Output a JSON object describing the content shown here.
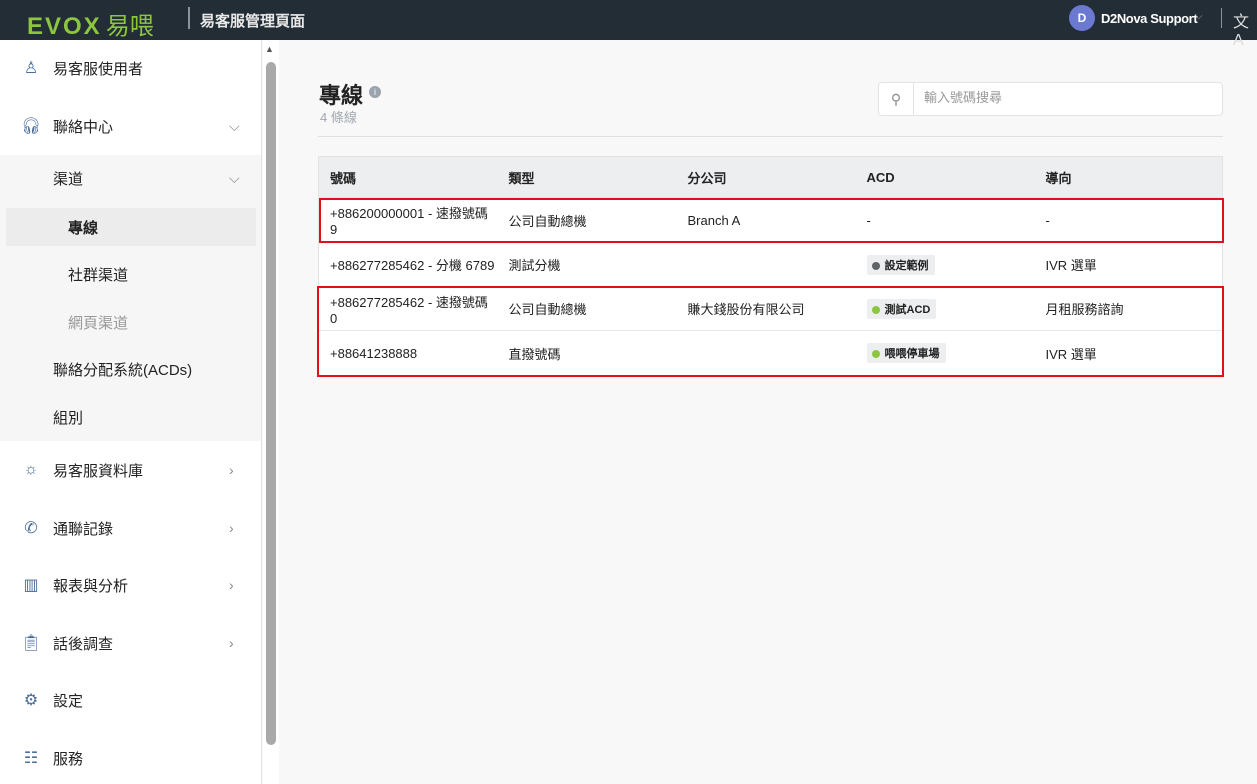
{
  "header": {
    "logo_text": "EVOX",
    "logo_cn": "易喂",
    "title": "易客服管理頁面",
    "avatar_initial": "D",
    "user_name": "D2Nova Support",
    "lang_icon": "translate-icon"
  },
  "sidebar": {
    "items": [
      {
        "label": "易客服使用者",
        "icon": "user-icon"
      },
      {
        "label": "聯絡中心",
        "icon": "headset-icon"
      },
      {
        "label": "渠道"
      },
      {
        "label": "專線"
      },
      {
        "label": "社群渠道"
      },
      {
        "label": "網頁渠道"
      },
      {
        "label": "聯絡分配系統(ACDs)"
      },
      {
        "label": "組別"
      },
      {
        "label": "易客服資料庫",
        "icon": "lightbulb-icon"
      },
      {
        "label": "通聯記錄",
        "icon": "phone-log-icon"
      },
      {
        "label": "報表與分析",
        "icon": "bar-chart-icon"
      },
      {
        "label": "話後調查",
        "icon": "clipboard-icon"
      },
      {
        "label": "設定",
        "icon": "gear-icon"
      },
      {
        "label": "服務",
        "icon": "list-icon"
      }
    ]
  },
  "main": {
    "title": "專線",
    "count": "4 條線",
    "search_placeholder": "輸入號碼搜尋",
    "columns": [
      "號碼",
      "類型",
      "分公司",
      "ACD",
      "導向"
    ],
    "rows": [
      {
        "number": "+886200000001 - 速撥號碼 9",
        "type": "公司自動總機",
        "branch": "Branch A",
        "acd": "-",
        "route": "-"
      },
      {
        "number": "+886277285462 - 分機 6789",
        "type": "測試分機",
        "branch": "",
        "acd": "設定範例",
        "acd_color": "#5f6368",
        "route": "IVR 選單"
      },
      {
        "number": "+886277285462 - 速撥號碼 0",
        "type": "公司自動總機",
        "branch": "賺大錢股份有限公司",
        "acd": "測試ACD",
        "acd_color": "#8cc63f",
        "route": "月租服務諮詢"
      },
      {
        "number": "+88641238888",
        "type": "直撥號碼",
        "branch": "",
        "acd": "喂喂停車場",
        "acd_color": "#8cc63f",
        "route": "IVR 選單"
      }
    ]
  }
}
